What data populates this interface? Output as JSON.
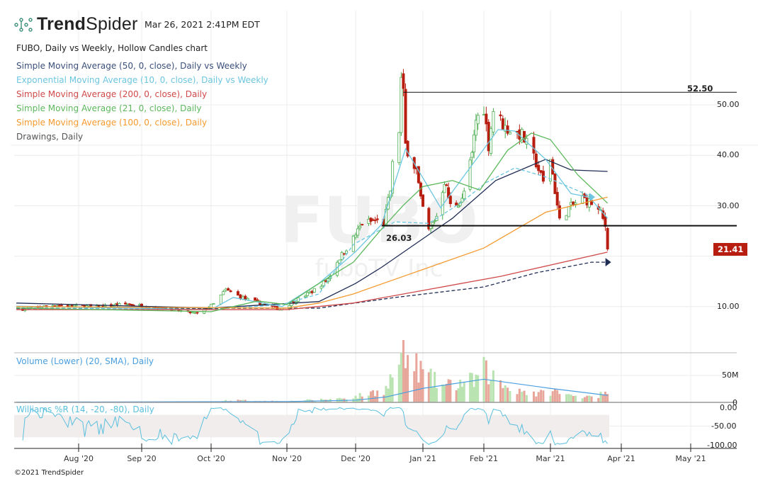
{
  "header": {
    "brand_bold": "Trend",
    "brand_light": "Spider",
    "timestamp": "Mar 26, 2021 2:41PM EDT",
    "chart_title": "FUBO, Daily vs Weekly, Hollow Candles chart"
  },
  "watermark": {
    "symbol": "FUBO",
    "company": "fuboTV Inc"
  },
  "legend": [
    {
      "label": "Simple Moving Average (50, 0, close), Daily vs Weekly",
      "color": "#3b4f7a"
    },
    {
      "label": "Exponential Moving Average (10, 0, close), Daily vs Weekly",
      "color": "#6cc6e0"
    },
    {
      "label": "Simple Moving Average (200, 0, close), Daily",
      "color": "#d0494a"
    },
    {
      "label": "Simple Moving Average (21, 0, close), Daily",
      "color": "#5cb85c"
    },
    {
      "label": "Simple Moving Average (100, 0, close), Daily",
      "color": "#f59a2e"
    },
    {
      "label": "Drawings, Daily",
      "color": "#555555"
    }
  ],
  "footer": "©2021 TrendSpider",
  "chart_data": [
    {
      "type": "candlestick",
      "style": "hollow",
      "symbol": "FUBO",
      "interval": "Daily",
      "y_ticks": [
        "50.00",
        "40.00",
        "30.00",
        "10.00"
      ],
      "y_tick_values": [
        50,
        40,
        30,
        10
      ],
      "ylim": [
        8,
        60
      ],
      "x_ticks": [
        "Aug '20",
        "Sep '20",
        "Oct '20",
        "Nov '20",
        "Dec '20",
        "Jan '21",
        "Feb '21",
        "Mar '21",
        "Apr '21",
        "May '21"
      ],
      "x_tick_dates": [
        "2020-08-01",
        "2020-09-01",
        "2020-10-01",
        "2020-11-01",
        "2020-12-01",
        "2021-01-01",
        "2021-02-01",
        "2021-03-01",
        "2021-04-01",
        "2021-05-01"
      ],
      "last_price": "21.41",
      "last_price_color": "#b81e10",
      "close_keypoints": [
        [
          "2020-07-06",
          9.5
        ],
        [
          "2020-07-20",
          10.3
        ],
        [
          "2020-08-10",
          10
        ],
        [
          "2020-08-25",
          10.5
        ],
        [
          "2020-09-10",
          9.7
        ],
        [
          "2020-09-25",
          8.6
        ],
        [
          "2020-10-02",
          10.5
        ],
        [
          "2020-10-07",
          13.3
        ],
        [
          "2020-10-15",
          11.5
        ],
        [
          "2020-10-29",
          9.5
        ],
        [
          "2020-11-04",
          11
        ],
        [
          "2020-11-12",
          13
        ],
        [
          "2020-11-19",
          15.5
        ],
        [
          "2020-11-23",
          19
        ],
        [
          "2020-11-30",
          23.5
        ],
        [
          "2020-12-04",
          26.5
        ],
        [
          "2020-12-10",
          27
        ],
        [
          "2020-12-14",
          26.5
        ],
        [
          "2020-12-17",
          33
        ],
        [
          "2020-12-18",
          38
        ],
        [
          "2020-12-21",
          45
        ],
        [
          "2020-12-22",
          55
        ],
        [
          "2020-12-23",
          52
        ],
        [
          "2020-12-24",
          42
        ],
        [
          "2020-12-29",
          37
        ],
        [
          "2020-12-31",
          31
        ],
        [
          "2021-01-04",
          25
        ],
        [
          "2021-01-08",
          28
        ],
        [
          "2021-01-12",
          35
        ],
        [
          "2021-01-15",
          30
        ],
        [
          "2021-01-21",
          31
        ],
        [
          "2021-01-26",
          40
        ],
        [
          "2021-01-28",
          47
        ],
        [
          "2021-02-01",
          49.5
        ],
        [
          "2021-02-03",
          42
        ],
        [
          "2021-02-05",
          49
        ],
        [
          "2021-02-10",
          45.5
        ],
        [
          "2021-02-17",
          44
        ],
        [
          "2021-02-23",
          38.5
        ],
        [
          "2021-02-26",
          34.5
        ],
        [
          "2021-03-01",
          39.5
        ],
        [
          "2021-03-03",
          33
        ],
        [
          "2021-03-05",
          27
        ],
        [
          "2021-03-09",
          29.5
        ],
        [
          "2021-03-15",
          31.5
        ],
        [
          "2021-03-19",
          30.5
        ],
        [
          "2021-03-23",
          28.5
        ],
        [
          "2021-03-25",
          26
        ],
        [
          "2021-03-26",
          21.41
        ]
      ],
      "indicators": [
        {
          "name": "SMA 50 Daily",
          "color": "#1f2d55",
          "dash": false,
          "points": [
            [
              "2020-07-03",
              10.7
            ],
            [
              "2020-10-01",
              9.7
            ],
            [
              "2020-11-15",
              11
            ],
            [
              "2020-12-01",
              14.6
            ],
            [
              "2020-12-13",
              17.8
            ],
            [
              "2021-01-16",
              27.5
            ],
            [
              "2021-02-06",
              35
            ],
            [
              "2021-02-27",
              39.2
            ],
            [
              "2021-03-10",
              37.1
            ],
            [
              "2021-03-26",
              36.8
            ]
          ]
        },
        {
          "name": "SMA 50 Weekly",
          "color": "#1f2d55",
          "dash": true,
          "marker": true,
          "points": [
            [
              "2020-07-03",
              9.6
            ],
            [
              "2020-11-15",
              9.7
            ],
            [
              "2020-12-19",
              11.8
            ],
            [
              "2021-02-01",
              13.9
            ],
            [
              "2021-02-23",
              16.7
            ],
            [
              "2021-03-19",
              18.8
            ],
            [
              "2021-03-26",
              18.8
            ]
          ]
        },
        {
          "name": "EMA 10 Daily",
          "color": "#6cc6e0",
          "dash": false,
          "points": [
            [
              "2020-07-03",
              10.1
            ],
            [
              "2020-10-01",
              9.4
            ],
            [
              "2020-10-10",
              11.8
            ],
            [
              "2020-10-30",
              10
            ],
            [
              "2020-11-15",
              14.6
            ],
            [
              "2020-12-01",
              20.9
            ],
            [
              "2020-12-13",
              26.3
            ],
            [
              "2020-12-24",
              41.3
            ],
            [
              "2021-01-10",
              29.6
            ],
            [
              "2021-02-07",
              45.1
            ],
            [
              "2021-02-14",
              44.8
            ],
            [
              "2021-02-27",
              39.2
            ],
            [
              "2021-03-10",
              32.4
            ],
            [
              "2021-03-18",
              31.7
            ],
            [
              "2021-03-26",
              27.5
            ]
          ]
        },
        {
          "name": "EMA 10 Weekly",
          "color": "#6cc6e0",
          "dash": true,
          "marker": true,
          "points": [
            [
              "2020-07-03",
              9.8
            ],
            [
              "2020-10-01",
              9.4
            ],
            [
              "2020-10-30",
              10.4
            ],
            [
              "2020-11-15",
              12.5
            ],
            [
              "2020-11-30",
              22.3
            ],
            [
              "2020-12-19",
              26.8
            ],
            [
              "2021-01-04",
              26.5
            ],
            [
              "2021-01-20",
              30.5
            ],
            [
              "2021-02-02",
              34.6
            ],
            [
              "2021-02-14",
              37.5
            ],
            [
              "2021-02-27",
              35.7
            ],
            [
              "2021-03-16",
              32.4
            ],
            [
              "2021-03-19",
              31.7
            ]
          ]
        },
        {
          "name": "SMA 200 Daily",
          "color": "#d0494a",
          "dash": false,
          "points": [
            [
              "2020-07-03",
              9.4
            ],
            [
              "2020-11-01",
              9.4
            ],
            [
              "2020-11-30",
              10.7
            ],
            [
              "2021-01-01",
              13.2
            ],
            [
              "2021-02-08",
              16
            ],
            [
              "2021-03-26",
              20.8
            ]
          ]
        },
        {
          "name": "SMA 21 Daily",
          "color": "#5cb85c",
          "dash": false,
          "points": [
            [
              "2020-07-03",
              9.7
            ],
            [
              "2020-10-01",
              9
            ],
            [
              "2020-10-20",
              11.1
            ],
            [
              "2020-11-01",
              10.4
            ],
            [
              "2020-11-15",
              14.6
            ],
            [
              "2020-11-30",
              18.8
            ],
            [
              "2020-12-13",
              25.4
            ],
            [
              "2020-12-23",
              30.1
            ],
            [
              "2021-01-01",
              33.8
            ],
            [
              "2021-01-16",
              35
            ],
            [
              "2021-01-30",
              33.1
            ],
            [
              "2021-02-11",
              41
            ],
            [
              "2021-02-21",
              44.4
            ],
            [
              "2021-03-01",
              43.1
            ],
            [
              "2021-03-13",
              36.1
            ],
            [
              "2021-03-26",
              30.5
            ]
          ]
        },
        {
          "name": "SMA 100 Daily",
          "color": "#f59a2e",
          "dash": false,
          "points": [
            [
              "2020-07-03",
              10
            ],
            [
              "2020-11-01",
              9.7
            ],
            [
              "2020-11-15",
              10.7
            ],
            [
              "2020-11-30",
              12.5
            ],
            [
              "2020-12-25",
              16.3
            ],
            [
              "2021-02-01",
              21.6
            ],
            [
              "2021-02-27",
              28.7
            ],
            [
              "2021-03-26",
              31.7
            ]
          ]
        }
      ],
      "drawings": [
        {
          "type": "hline",
          "value": 52.5,
          "label": "52.50",
          "from": "2020-12-23"
        },
        {
          "type": "hline",
          "value": 26.03,
          "label": "26.03",
          "from": "2020-12-13"
        }
      ]
    },
    {
      "type": "bar",
      "title": "Volume (Lower) (20, SMA), Daily",
      "color": "#4a9fe0",
      "y_ticks": [
        "50M",
        "0"
      ],
      "y_tick_values": [
        50,
        0
      ],
      "unit": "M",
      "volume_keypoints": [
        [
          "2020-07-06",
          0.6
        ],
        [
          "2020-10-01",
          1
        ],
        [
          "2020-10-08",
          4
        ],
        [
          "2020-11-01",
          2
        ],
        [
          "2020-11-20",
          6
        ],
        [
          "2020-12-01",
          10
        ],
        [
          "2020-12-15",
          25
        ],
        [
          "2020-12-22",
          83
        ],
        [
          "2020-12-28",
          70
        ],
        [
          "2021-01-04",
          45
        ],
        [
          "2021-01-12",
          30
        ],
        [
          "2021-01-27",
          40
        ],
        [
          "2021-02-01",
          60
        ],
        [
          "2021-02-10",
          30
        ],
        [
          "2021-02-24",
          15
        ],
        [
          "2021-03-01",
          22
        ],
        [
          "2021-03-10",
          12
        ],
        [
          "2021-03-26",
          15
        ]
      ],
      "sma_points": [
        [
          "2020-07-03",
          0.5
        ],
        [
          "2020-11-01",
          1.5
        ],
        [
          "2020-12-01",
          4
        ],
        [
          "2020-12-15",
          10
        ],
        [
          "2021-01-01",
          26
        ],
        [
          "2021-02-01",
          43
        ],
        [
          "2021-03-01",
          26
        ],
        [
          "2021-03-26",
          13
        ]
      ],
      "up_color": "#b9e3b0",
      "down_color": "#e8a59a"
    },
    {
      "type": "line",
      "title": "Williams %R (14, -20, -80), Daily",
      "color": "#5bc0de",
      "period": 14,
      "band": [
        -20,
        -80
      ],
      "y_ticks": [
        "0.00",
        "-50.00",
        "-100.00"
      ],
      "y_tick_values": [
        0,
        -50,
        -100
      ],
      "ylim": [
        -100,
        0
      ]
    }
  ]
}
